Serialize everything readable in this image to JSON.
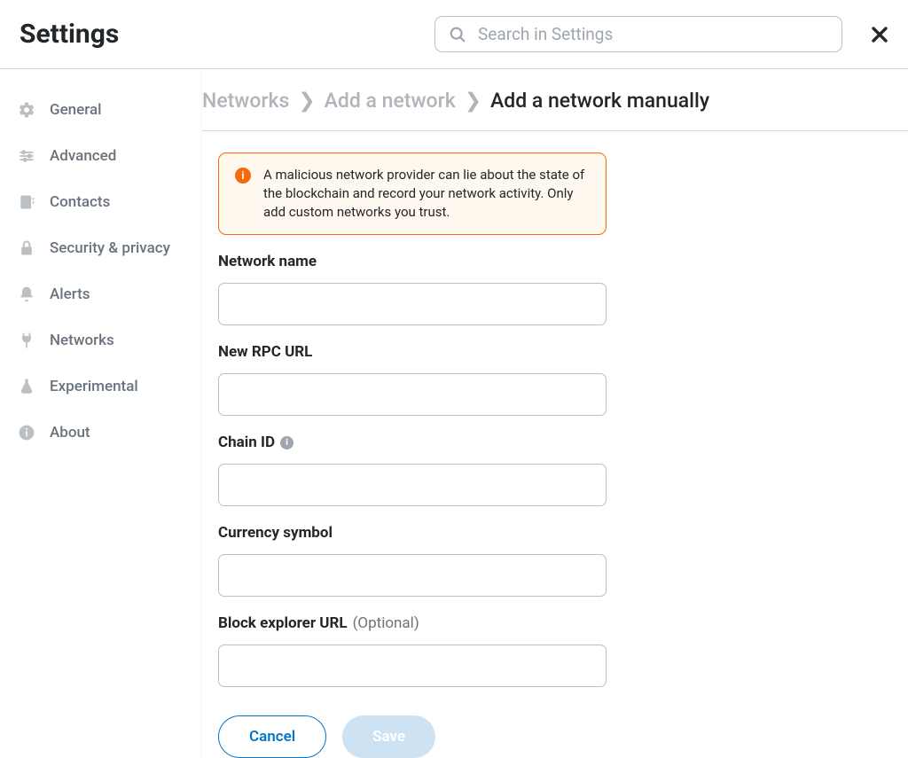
{
  "header": {
    "title": "Settings",
    "search_placeholder": "Search in Settings"
  },
  "sidebar": {
    "items": [
      {
        "id": "general",
        "label": "General"
      },
      {
        "id": "advanced",
        "label": "Advanced"
      },
      {
        "id": "contacts",
        "label": "Contacts"
      },
      {
        "id": "security",
        "label": "Security & privacy"
      },
      {
        "id": "alerts",
        "label": "Alerts"
      },
      {
        "id": "networks",
        "label": "Networks"
      },
      {
        "id": "experimental",
        "label": "Experimental"
      },
      {
        "id": "about",
        "label": "About"
      }
    ]
  },
  "breadcrumb": {
    "level1": "Networks",
    "level2": "Add a network",
    "current": "Add a network manually"
  },
  "warning": {
    "text": "A malicious network provider can lie about the state of the blockchain and record your network activity. Only add custom networks you trust."
  },
  "form": {
    "network_name": {
      "label": "Network name",
      "value": ""
    },
    "new_rpc_url": {
      "label": "New RPC URL",
      "value": ""
    },
    "chain_id": {
      "label": "Chain ID",
      "value": ""
    },
    "currency_symbol": {
      "label": "Currency symbol",
      "value": ""
    },
    "block_explorer": {
      "label": "Block explorer URL",
      "optional": "(Optional)",
      "value": ""
    }
  },
  "buttons": {
    "cancel": "Cancel",
    "save": "Save"
  },
  "colors": {
    "accent": "#0376c9",
    "warn_border": "#f66a0a",
    "warn_bg": "#fff8ef"
  }
}
